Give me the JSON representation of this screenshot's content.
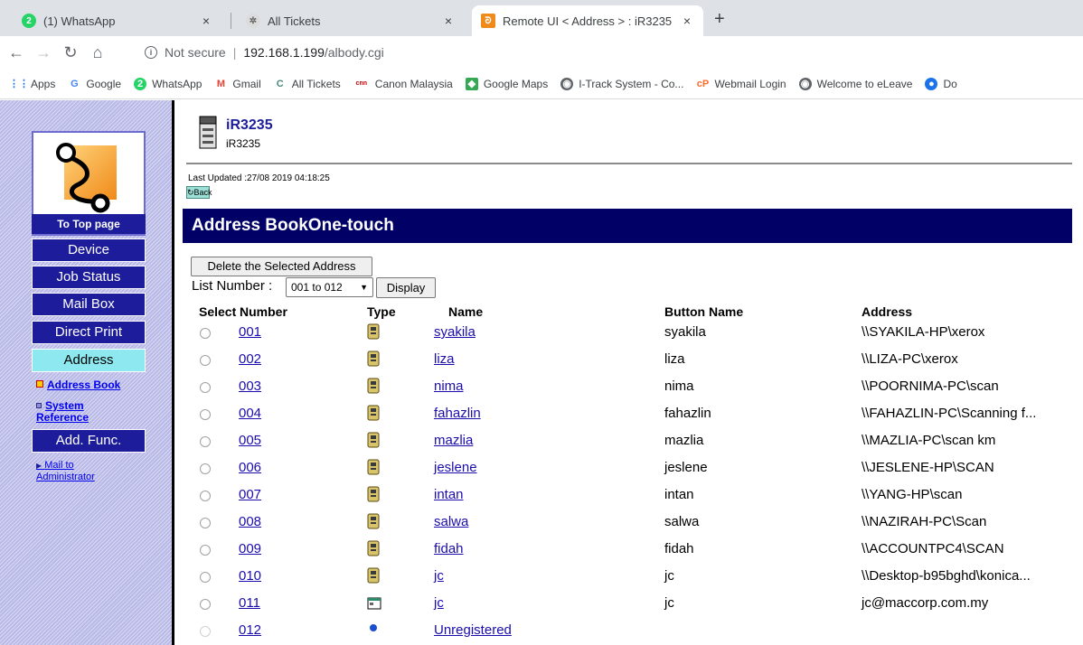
{
  "browser": {
    "tabs": [
      {
        "title": "(1) WhatsApp",
        "close": "×"
      },
      {
        "title": "All Tickets",
        "close": "×"
      },
      {
        "title": "Remote UI < Address > : iR3235",
        "close": "×"
      }
    ],
    "new_tab": "+",
    "url": {
      "security": "Not secure",
      "host": "192.168.1.199",
      "path": "/albody.cgi"
    },
    "bookmarks": [
      "Apps",
      "Google",
      "WhatsApp",
      "Gmail",
      "All Tickets",
      "Canon Malaysia",
      "Google Maps",
      "I-Track System - Co...",
      "Webmail Login",
      "Welcome to eLeave",
      "Do"
    ]
  },
  "sidebar": {
    "top_page": "To Top page",
    "buttons": [
      "Device",
      "Job Status",
      "Mail Box",
      "Direct Print",
      "Address",
      "Add. Func."
    ],
    "address_book": "Address Book",
    "system_reference_1": "System",
    "system_reference_2": "Reference",
    "mail_admin_1": "Mail to",
    "mail_admin_2": "Administrator"
  },
  "device": {
    "title": "iR3235",
    "subtitle": "iR3235"
  },
  "last_updated": "Last Updated :27/08 2019 04:18:25",
  "back_label": "Back",
  "section_title": "Address BookOne-touch",
  "delete_button": "Delete the Selected Address",
  "list_number_label": "List Number :",
  "list_number_value": "001 to 012",
  "display_button": "Display",
  "columns": {
    "select": "Select",
    "number": "Number",
    "type": "Type",
    "name": "Name",
    "button_name": "Button Name",
    "address": "Address"
  },
  "rows": [
    {
      "number": "001",
      "type": "file-server",
      "name": "syakila",
      "button_name": "syakila",
      "address": "\\\\SYAKILA-HP\\xerox"
    },
    {
      "number": "002",
      "type": "file-server",
      "name": "liza",
      "button_name": "liza",
      "address": "\\\\LIZA-PC\\xerox"
    },
    {
      "number": "003",
      "type": "file-server",
      "name": "nima",
      "button_name": "nima",
      "address": "\\\\POORNIMA-PC\\scan"
    },
    {
      "number": "004",
      "type": "file-server",
      "name": "fahazlin",
      "button_name": "fahazlin",
      "address": "\\\\FAHAZLIN-PC\\Scanning f..."
    },
    {
      "number": "005",
      "type": "file-server",
      "name": "mazlia",
      "button_name": "mazlia",
      "address": "\\\\MAZLIA-PC\\scan km"
    },
    {
      "number": "006",
      "type": "file-server",
      "name": "jeslene",
      "button_name": "jeslene",
      "address": "\\\\JESLENE-HP\\SCAN"
    },
    {
      "number": "007",
      "type": "file-server",
      "name": "intan",
      "button_name": "intan",
      "address": "\\\\YANG-HP\\scan"
    },
    {
      "number": "008",
      "type": "file-server",
      "name": "salwa",
      "button_name": "salwa",
      "address": "\\\\NAZIRAH-PC\\Scan"
    },
    {
      "number": "009",
      "type": "file-server",
      "name": "fidah",
      "button_name": "fidah",
      "address": "\\\\ACCOUNTPC4\\SCAN"
    },
    {
      "number": "010",
      "type": "file-server",
      "name": "jc",
      "button_name": "jc",
      "address": "\\\\Desktop-b95bghd\\konica..."
    },
    {
      "number": "011",
      "type": "email",
      "name": "jc",
      "button_name": "jc",
      "address": "jc@maccorp.com.my"
    },
    {
      "number": "012",
      "type": "unregistered",
      "name": "Unregistered",
      "button_name": "",
      "address": ""
    }
  ]
}
